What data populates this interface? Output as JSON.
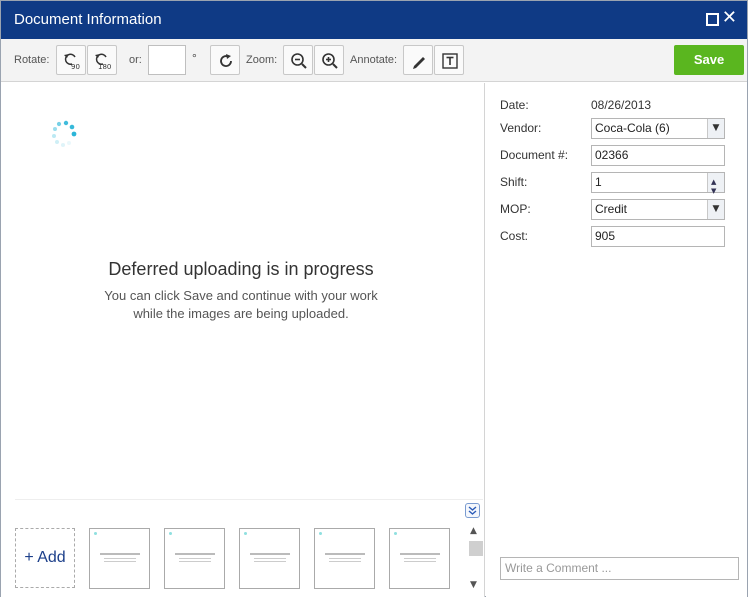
{
  "window": {
    "title": "Document Information",
    "maximize_icon": "maximize-icon",
    "close_icon": "close-icon",
    "close_glyph": "✕"
  },
  "toolbar": {
    "rotate_label": "Rotate:",
    "rotate90_sub": "90",
    "rotate180_sub": "180",
    "or_label": "or:",
    "degree_symbol": "°",
    "rotate_value": "",
    "zoom_label": "Zoom:",
    "annotate_label": "Annotate:",
    "save_label": "Save",
    "save_color": "#5ab61f"
  },
  "viewer": {
    "title": "Deferred uploading is in progress",
    "line1": "You can click Save and continue with your work",
    "line2": "while the images are being uploaded.",
    "spinner_color": "#2bb5d8"
  },
  "thumbnails": {
    "add_label": "+ Add",
    "count": 5
  },
  "form": {
    "date_label": "Date:",
    "date_value": "08/26/2013",
    "vendor_label": "Vendor:",
    "vendor_value": "Coca-Cola (6)",
    "document_label": "Document #:",
    "document_value": "02366",
    "shift_label": "Shift:",
    "shift_value": "1",
    "mop_label": "MOP:",
    "mop_value": "Credit",
    "cost_label": "Cost:",
    "cost_value": "905",
    "comment_placeholder": "Write a Comment ..."
  },
  "colors": {
    "titlebar": "#0f3a85",
    "accent": "#1c3f8a"
  }
}
